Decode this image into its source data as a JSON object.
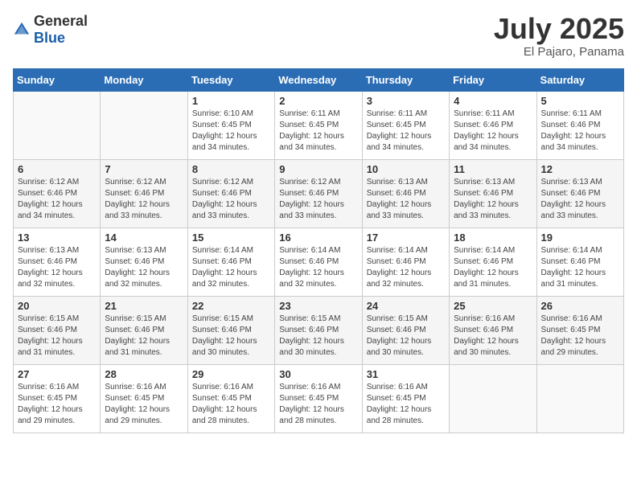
{
  "logo": {
    "general": "General",
    "blue": "Blue"
  },
  "title": {
    "month_year": "July 2025",
    "location": "El Pajaro, Panama"
  },
  "days_of_week": [
    "Sunday",
    "Monday",
    "Tuesday",
    "Wednesday",
    "Thursday",
    "Friday",
    "Saturday"
  ],
  "weeks": [
    [
      {
        "day": "",
        "sunrise": "",
        "sunset": "",
        "daylight": ""
      },
      {
        "day": "",
        "sunrise": "",
        "sunset": "",
        "daylight": ""
      },
      {
        "day": "1",
        "sunrise": "Sunrise: 6:10 AM",
        "sunset": "Sunset: 6:45 PM",
        "daylight": "Daylight: 12 hours and 34 minutes."
      },
      {
        "day": "2",
        "sunrise": "Sunrise: 6:11 AM",
        "sunset": "Sunset: 6:45 PM",
        "daylight": "Daylight: 12 hours and 34 minutes."
      },
      {
        "day": "3",
        "sunrise": "Sunrise: 6:11 AM",
        "sunset": "Sunset: 6:45 PM",
        "daylight": "Daylight: 12 hours and 34 minutes."
      },
      {
        "day": "4",
        "sunrise": "Sunrise: 6:11 AM",
        "sunset": "Sunset: 6:46 PM",
        "daylight": "Daylight: 12 hours and 34 minutes."
      },
      {
        "day": "5",
        "sunrise": "Sunrise: 6:11 AM",
        "sunset": "Sunset: 6:46 PM",
        "daylight": "Daylight: 12 hours and 34 minutes."
      }
    ],
    [
      {
        "day": "6",
        "sunrise": "Sunrise: 6:12 AM",
        "sunset": "Sunset: 6:46 PM",
        "daylight": "Daylight: 12 hours and 34 minutes."
      },
      {
        "day": "7",
        "sunrise": "Sunrise: 6:12 AM",
        "sunset": "Sunset: 6:46 PM",
        "daylight": "Daylight: 12 hours and 33 minutes."
      },
      {
        "day": "8",
        "sunrise": "Sunrise: 6:12 AM",
        "sunset": "Sunset: 6:46 PM",
        "daylight": "Daylight: 12 hours and 33 minutes."
      },
      {
        "day": "9",
        "sunrise": "Sunrise: 6:12 AM",
        "sunset": "Sunset: 6:46 PM",
        "daylight": "Daylight: 12 hours and 33 minutes."
      },
      {
        "day": "10",
        "sunrise": "Sunrise: 6:13 AM",
        "sunset": "Sunset: 6:46 PM",
        "daylight": "Daylight: 12 hours and 33 minutes."
      },
      {
        "day": "11",
        "sunrise": "Sunrise: 6:13 AM",
        "sunset": "Sunset: 6:46 PM",
        "daylight": "Daylight: 12 hours and 33 minutes."
      },
      {
        "day": "12",
        "sunrise": "Sunrise: 6:13 AM",
        "sunset": "Sunset: 6:46 PM",
        "daylight": "Daylight: 12 hours and 33 minutes."
      }
    ],
    [
      {
        "day": "13",
        "sunrise": "Sunrise: 6:13 AM",
        "sunset": "Sunset: 6:46 PM",
        "daylight": "Daylight: 12 hours and 32 minutes."
      },
      {
        "day": "14",
        "sunrise": "Sunrise: 6:13 AM",
        "sunset": "Sunset: 6:46 PM",
        "daylight": "Daylight: 12 hours and 32 minutes."
      },
      {
        "day": "15",
        "sunrise": "Sunrise: 6:14 AM",
        "sunset": "Sunset: 6:46 PM",
        "daylight": "Daylight: 12 hours and 32 minutes."
      },
      {
        "day": "16",
        "sunrise": "Sunrise: 6:14 AM",
        "sunset": "Sunset: 6:46 PM",
        "daylight": "Daylight: 12 hours and 32 minutes."
      },
      {
        "day": "17",
        "sunrise": "Sunrise: 6:14 AM",
        "sunset": "Sunset: 6:46 PM",
        "daylight": "Daylight: 12 hours and 32 minutes."
      },
      {
        "day": "18",
        "sunrise": "Sunrise: 6:14 AM",
        "sunset": "Sunset: 6:46 PM",
        "daylight": "Daylight: 12 hours and 31 minutes."
      },
      {
        "day": "19",
        "sunrise": "Sunrise: 6:14 AM",
        "sunset": "Sunset: 6:46 PM",
        "daylight": "Daylight: 12 hours and 31 minutes."
      }
    ],
    [
      {
        "day": "20",
        "sunrise": "Sunrise: 6:15 AM",
        "sunset": "Sunset: 6:46 PM",
        "daylight": "Daylight: 12 hours and 31 minutes."
      },
      {
        "day": "21",
        "sunrise": "Sunrise: 6:15 AM",
        "sunset": "Sunset: 6:46 PM",
        "daylight": "Daylight: 12 hours and 31 minutes."
      },
      {
        "day": "22",
        "sunrise": "Sunrise: 6:15 AM",
        "sunset": "Sunset: 6:46 PM",
        "daylight": "Daylight: 12 hours and 30 minutes."
      },
      {
        "day": "23",
        "sunrise": "Sunrise: 6:15 AM",
        "sunset": "Sunset: 6:46 PM",
        "daylight": "Daylight: 12 hours and 30 minutes."
      },
      {
        "day": "24",
        "sunrise": "Sunrise: 6:15 AM",
        "sunset": "Sunset: 6:46 PM",
        "daylight": "Daylight: 12 hours and 30 minutes."
      },
      {
        "day": "25",
        "sunrise": "Sunrise: 6:16 AM",
        "sunset": "Sunset: 6:46 PM",
        "daylight": "Daylight: 12 hours and 30 minutes."
      },
      {
        "day": "26",
        "sunrise": "Sunrise: 6:16 AM",
        "sunset": "Sunset: 6:45 PM",
        "daylight": "Daylight: 12 hours and 29 minutes."
      }
    ],
    [
      {
        "day": "27",
        "sunrise": "Sunrise: 6:16 AM",
        "sunset": "Sunset: 6:45 PM",
        "daylight": "Daylight: 12 hours and 29 minutes."
      },
      {
        "day": "28",
        "sunrise": "Sunrise: 6:16 AM",
        "sunset": "Sunset: 6:45 PM",
        "daylight": "Daylight: 12 hours and 29 minutes."
      },
      {
        "day": "29",
        "sunrise": "Sunrise: 6:16 AM",
        "sunset": "Sunset: 6:45 PM",
        "daylight": "Daylight: 12 hours and 28 minutes."
      },
      {
        "day": "30",
        "sunrise": "Sunrise: 6:16 AM",
        "sunset": "Sunset: 6:45 PM",
        "daylight": "Daylight: 12 hours and 28 minutes."
      },
      {
        "day": "31",
        "sunrise": "Sunrise: 6:16 AM",
        "sunset": "Sunset: 6:45 PM",
        "daylight": "Daylight: 12 hours and 28 minutes."
      },
      {
        "day": "",
        "sunrise": "",
        "sunset": "",
        "daylight": ""
      },
      {
        "day": "",
        "sunrise": "",
        "sunset": "",
        "daylight": ""
      }
    ]
  ]
}
